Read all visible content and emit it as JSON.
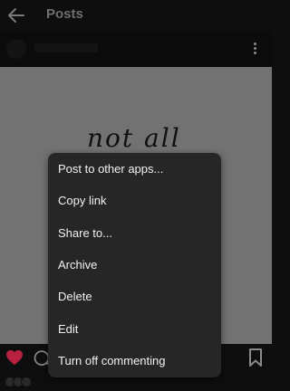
{
  "header": {
    "title": "Posts",
    "back_icon": "arrow-left-icon"
  },
  "post": {
    "image_text": "not all",
    "more_icon": "more-vertical-icon"
  },
  "actions": {
    "like_icon": "heart-icon",
    "like_color": "#e0245e",
    "comment_icon": "comment-icon",
    "bookmark_icon": "bookmark-icon"
  },
  "menu": {
    "background": "#262626",
    "items": [
      {
        "label": "Post to other apps..."
      },
      {
        "label": "Copy link"
      },
      {
        "label": "Share to..."
      },
      {
        "label": "Archive"
      },
      {
        "label": "Delete"
      },
      {
        "label": "Edit"
      },
      {
        "label": "Turn off commenting"
      }
    ]
  }
}
